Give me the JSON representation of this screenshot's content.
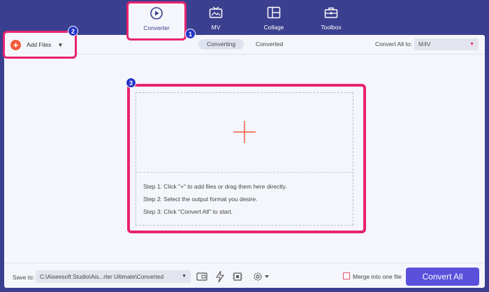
{
  "nav": {
    "tabs": [
      {
        "label": "Converter",
        "icon": "converter-icon",
        "active": true
      },
      {
        "label": "MV",
        "icon": "tv-icon"
      },
      {
        "label": "Collage",
        "icon": "collage-icon"
      },
      {
        "label": "Toolbox",
        "icon": "toolbox-icon"
      }
    ]
  },
  "badges": [
    "1",
    "2",
    "3"
  ],
  "toolbar": {
    "add_files_label": "Add Files",
    "segments": [
      "Converting",
      "Converted"
    ],
    "convert_all_to_label": "Convert All to:",
    "format_value": "M4V"
  },
  "dropzone": {
    "steps": [
      "Step 1: Click \"+\" to add files or drag them here directly.",
      "Step 2: Select the output format you desire.",
      "Step 3: Click \"Convert All\" to start."
    ]
  },
  "bottom": {
    "save_to_label": "Save to:",
    "path_value": "C:\\Aiseesoft Studio\\Ais...rter Ultimate\\Converted",
    "merge_label": "Merge into one file",
    "convert_all_button": "Convert All"
  },
  "colors": {
    "background": "#3b3f8f",
    "highlight": "#e8236f",
    "badge": "#2434c8",
    "accent_button": "#5a50dc",
    "add_icon": "#f05a3c"
  }
}
